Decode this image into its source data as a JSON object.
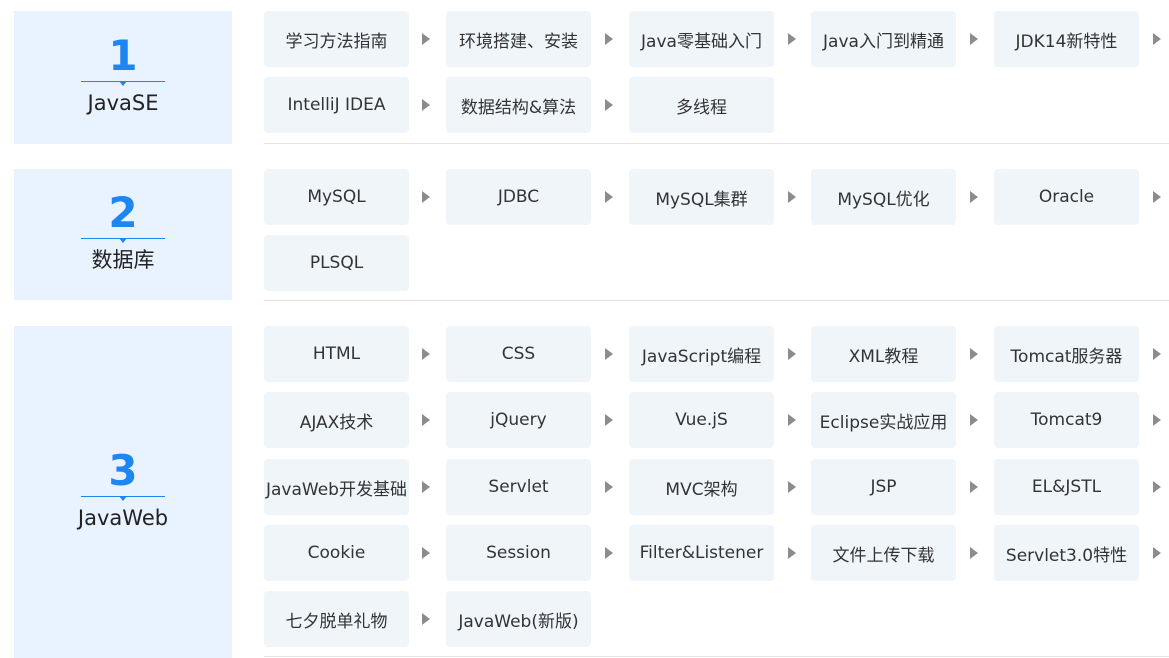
{
  "sections": [
    {
      "number": "1",
      "title": "JavaSE",
      "items": [
        "学习方法指南",
        "环境搭建、安装",
        "Java零基础入门",
        "Java入门到精通",
        "JDK14新特性",
        "IntelliJ IDEA",
        "数据结构&算法",
        "多线程"
      ]
    },
    {
      "number": "2",
      "title": "数据库",
      "items": [
        "MySQL",
        "JDBC",
        "MySQL集群",
        "MySQL优化",
        "Oracle",
        "PLSQL"
      ]
    },
    {
      "number": "3",
      "title": "JavaWeb",
      "items": [
        "HTML",
        "CSS",
        "JavaScript编程",
        "XML教程",
        "Tomcat服务器",
        "AJAX技术",
        "jQuery",
        "Vue.jS",
        "Eclipse实战应用",
        "Tomcat9",
        "JavaWeb开发基础",
        "Servlet",
        "MVC架构",
        "JSP",
        "EL&JSTL",
        "Cookie",
        "Session",
        "Filter&Listener",
        "文件上传下载",
        "Servlet3.0特性",
        "七夕脱单礼物",
        "JavaWeb(新版)"
      ]
    }
  ],
  "icons": {
    "arrow": "triangle-right-icon"
  },
  "colors": {
    "accent": "#1e86f0",
    "step_background": "#e8f3ff",
    "item_background": "#f0f5fa",
    "arrow": "#8c8c8c"
  }
}
